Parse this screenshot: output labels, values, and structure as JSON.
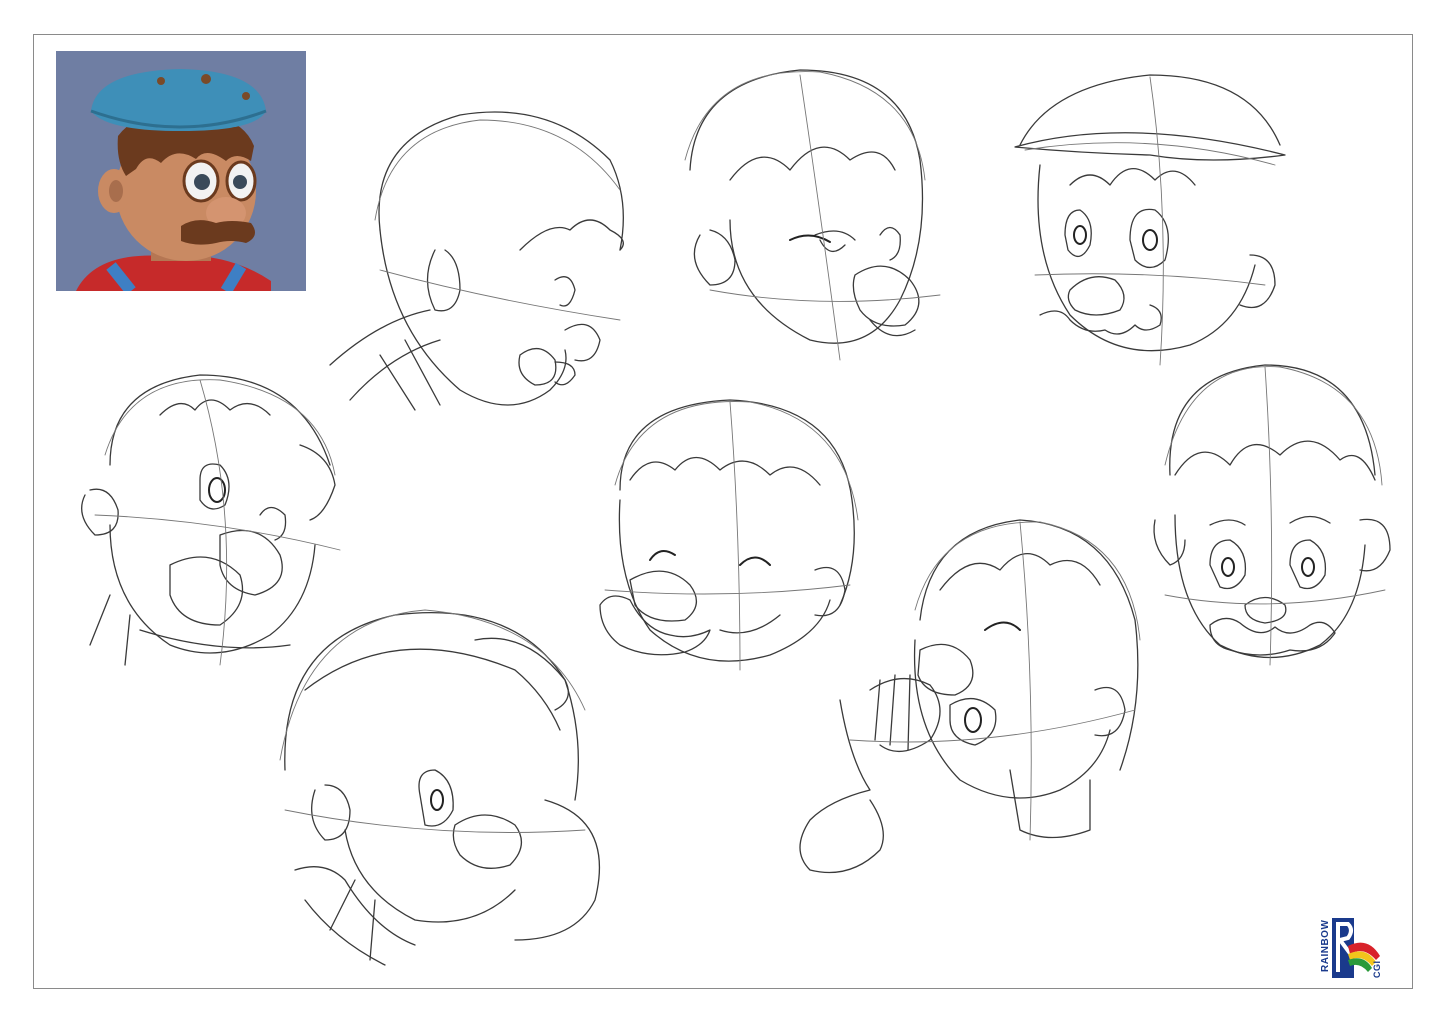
{
  "logo": {
    "brand_top": "RAINBOW",
    "brand_bottom": "CGI",
    "colors": {
      "blue": "#1a3a8c",
      "red": "#d8222a",
      "yellow": "#f2c51c",
      "green": "#2a9a3a"
    }
  },
  "reference_render": {
    "icon": "character-3d-render",
    "colors": {
      "background": "#6f7ea3",
      "cap": "#3e8fb8",
      "skin": "#c98a63",
      "hair": "#6b3a1e",
      "shirt": "#c62a2a",
      "straps": "#3e7fc4"
    }
  },
  "sketches": [
    {
      "icon": "head-sketch-profile-right"
    },
    {
      "icon": "head-sketch-three-quarter-down"
    },
    {
      "icon": "head-sketch-with-cap"
    },
    {
      "icon": "head-sketch-laughing"
    },
    {
      "icon": "head-sketch-smiling-eyes-closed"
    },
    {
      "icon": "head-sketch-worried-front"
    },
    {
      "icon": "head-sketch-looking-down"
    },
    {
      "icon": "head-sketch-whistling-hand"
    }
  ]
}
